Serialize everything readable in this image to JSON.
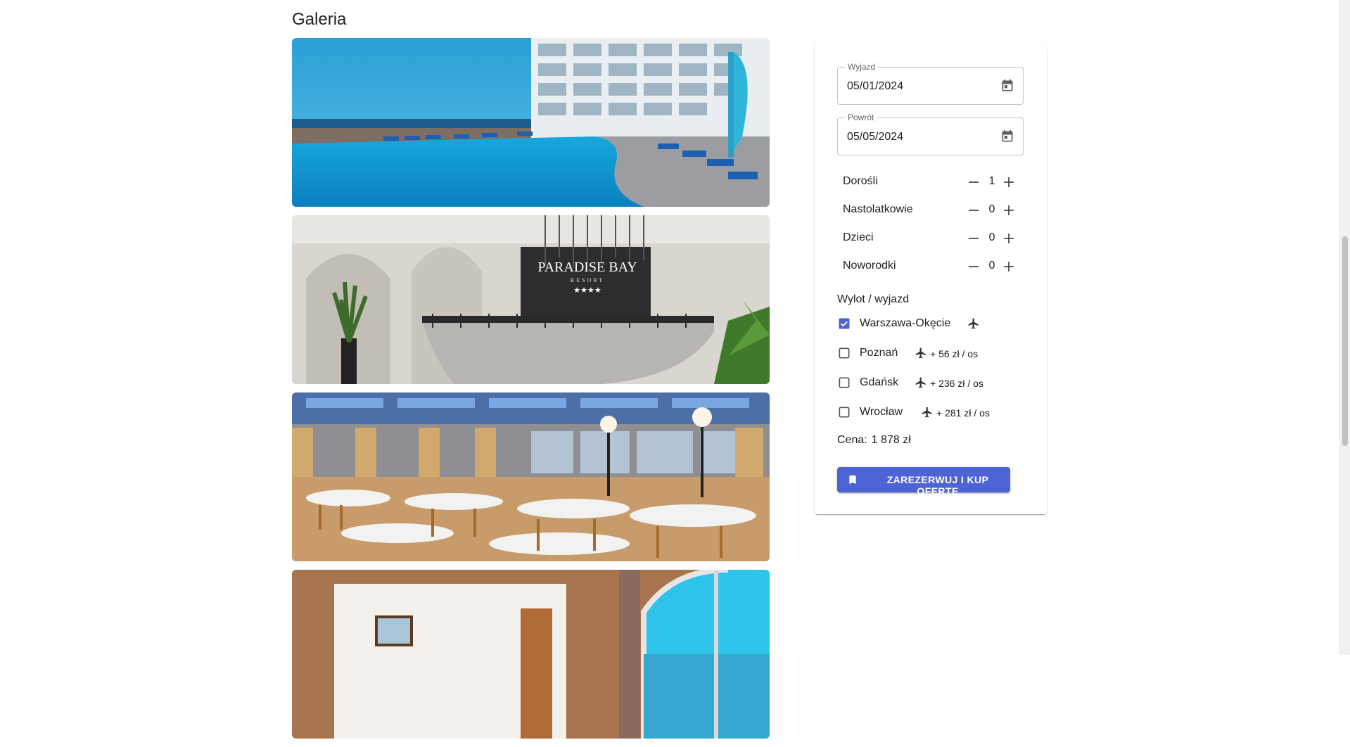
{
  "gallery": {
    "title": "Galeria",
    "photos": [
      {
        "name": "pool"
      },
      {
        "name": "reception",
        "sign_text": "PARADISE BAY",
        "sign_sub": "RESORT",
        "sign_stars": "★★★★"
      },
      {
        "name": "restaurant"
      },
      {
        "name": "room"
      }
    ]
  },
  "booking": {
    "departure": {
      "label": "Wyjazd",
      "value": "05/01/2024",
      "icon": "calendar-icon"
    },
    "return": {
      "label": "Powrót",
      "value": "05/05/2024",
      "icon": "calendar-icon"
    },
    "travellers": [
      {
        "label": "Dorośli",
        "count": "1"
      },
      {
        "label": "Nastolatkowie",
        "count": "0"
      },
      {
        "label": "Dzieci",
        "count": "0"
      },
      {
        "label": "Noworodki",
        "count": "0"
      }
    ],
    "departure_section_label": "Wylot / wyjazd",
    "airports": [
      {
        "label": "Warszawa-Okęcie",
        "checked": true,
        "extra": ""
      },
      {
        "label": "Poznań",
        "checked": false,
        "extra": "+ 56 zł / os"
      },
      {
        "label": "Gdańsk",
        "checked": false,
        "extra": "+ 236 zł / os"
      },
      {
        "label": "Wrocław",
        "checked": false,
        "extra": "+ 281 zł / os"
      }
    ],
    "price_label": "Cena:",
    "price_value": "1 878 zł",
    "book_button": "ZAREZERWUJ I KUP OFERTĘ",
    "accent_color": "#4e63d6"
  }
}
